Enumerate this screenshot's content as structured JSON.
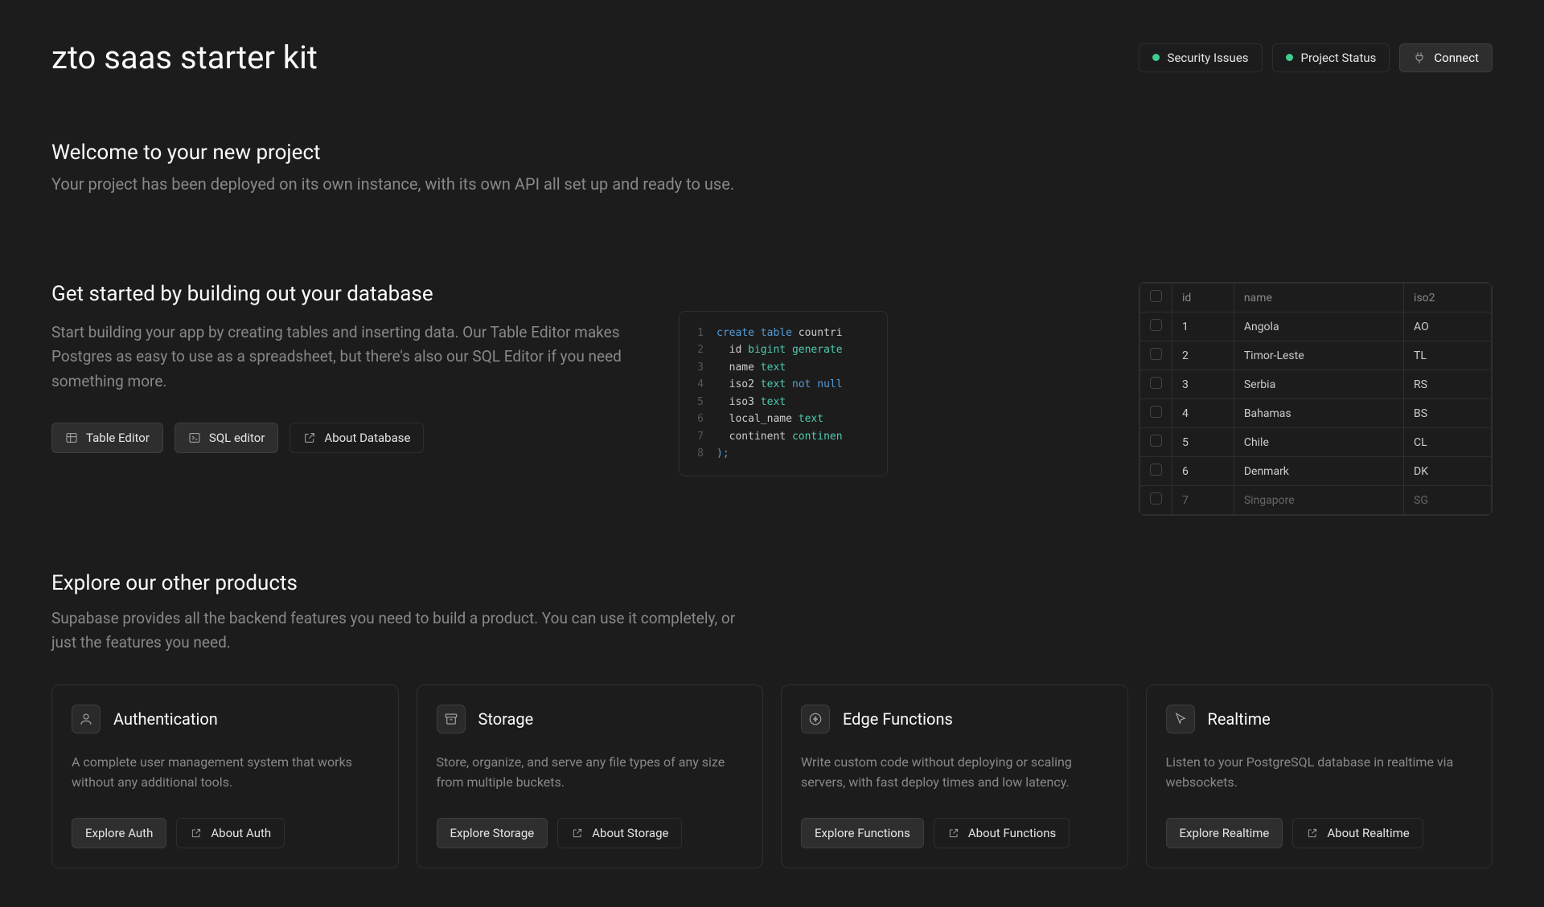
{
  "header": {
    "title": "zto saas starter kit",
    "security": "Security Issues",
    "status": "Project Status",
    "connect": "Connect"
  },
  "welcome": {
    "heading": "Welcome to your new project",
    "sub": "Your project has been deployed on its own instance, with its own API all set up and ready to use."
  },
  "db": {
    "heading": "Get started by building out your database",
    "body": "Start building your app by creating tables and inserting data. Our Table Editor makes Postgres as easy to use as a spreadsheet, but there's also our SQL Editor if you need something more.",
    "table_editor": "Table Editor",
    "sql_editor": "SQL editor",
    "about": "About Database"
  },
  "code": {
    "l1a": "create",
    "l1b": "table",
    "l1c": "countri",
    "l2a": "id",
    "l2b": "bigint",
    "l2c": "generate",
    "l3a": "name",
    "l3b": "text",
    "l4a": "iso2",
    "l4b": "text",
    "l4c": "not",
    "l4d": "null",
    "l5a": "iso3",
    "l5b": "text",
    "l6a": "local_name",
    "l6b": "text",
    "l7a": "continent",
    "l7b": "continen",
    "l8": ");",
    "ln": [
      "1",
      "2",
      "3",
      "4",
      "5",
      "6",
      "7",
      "8"
    ]
  },
  "table": {
    "cols": [
      "id",
      "name",
      "iso2"
    ],
    "rows": [
      {
        "id": "1",
        "name": "Angola",
        "iso2": "AO"
      },
      {
        "id": "2",
        "name": "Timor-Leste",
        "iso2": "TL"
      },
      {
        "id": "3",
        "name": "Serbia",
        "iso2": "RS"
      },
      {
        "id": "4",
        "name": "Bahamas",
        "iso2": "BS"
      },
      {
        "id": "5",
        "name": "Chile",
        "iso2": "CL"
      },
      {
        "id": "6",
        "name": "Denmark",
        "iso2": "DK"
      },
      {
        "id": "7",
        "name": "Singapore",
        "iso2": "SG"
      }
    ]
  },
  "explore": {
    "heading": "Explore our other products",
    "sub": "Supabase provides all the backend features you need to build a product. You can use it completely, or just the features you need."
  },
  "cards": [
    {
      "title": "Authentication",
      "desc": "A complete user management system that works without any additional tools.",
      "explore": "Explore Auth",
      "about": "About Auth"
    },
    {
      "title": "Storage",
      "desc": "Store, organize, and serve any file types of any size from multiple buckets.",
      "explore": "Explore Storage",
      "about": "About Storage"
    },
    {
      "title": "Edge Functions",
      "desc": "Write custom code without deploying or scaling servers, with fast deploy times and low latency.",
      "explore": "Explore Functions",
      "about": "About Functions"
    },
    {
      "title": "Realtime",
      "desc": "Listen to your PostgreSQL database in realtime via websockets.",
      "explore": "Explore Realtime",
      "about": "About Realtime"
    }
  ]
}
